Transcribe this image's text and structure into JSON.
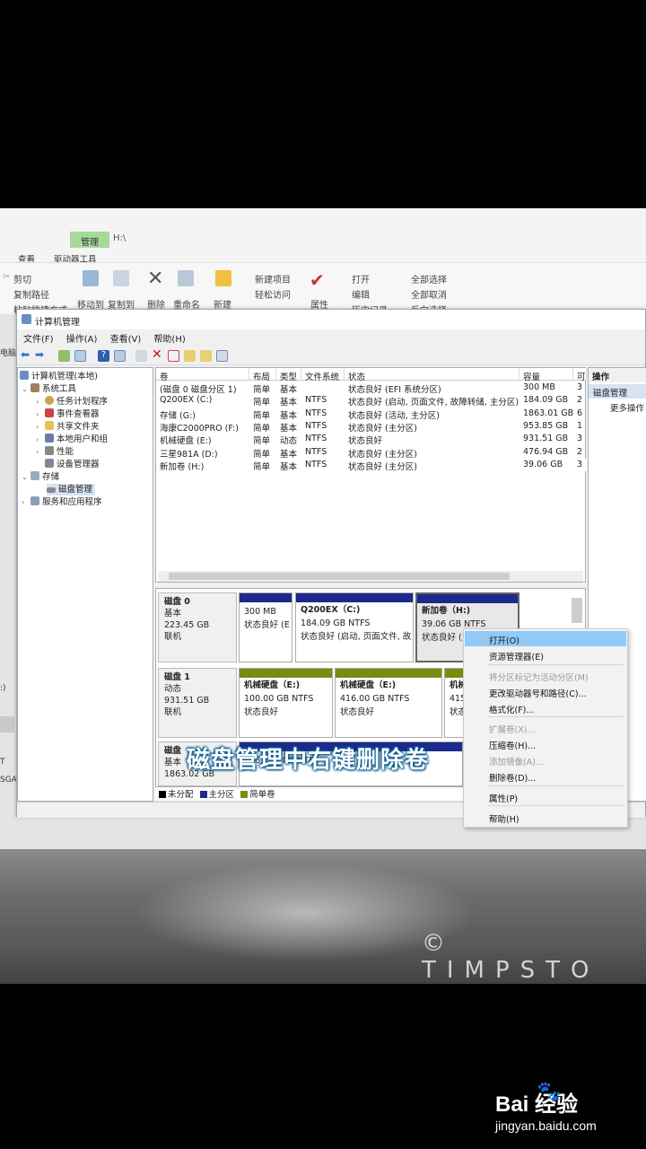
{
  "ribbon": {
    "manage_tab": "管理",
    "path": "H:\\",
    "view_tab": "查看",
    "drive_tools_tab": "驱动器工具",
    "cut": "剪切",
    "copy_path": "复制路径",
    "paste_shortcut": "粘贴快捷方式",
    "move_to": "移动到",
    "copy_to": "复制到",
    "delete": "删除",
    "rename": "重命名",
    "new": "新建",
    "new_item": "新建项目",
    "easy_access": "轻松访问",
    "properties": "属性",
    "open": "打开",
    "edit": "编辑",
    "history": "历史记录",
    "select_all": "全部选择",
    "select_none": "全部取消",
    "invert_selection": "反向选择"
  },
  "left_edge": {
    "text1": "电脑",
    "text2": ":)",
    "text3": "T",
    "text4": "SGA"
  },
  "window": {
    "title": "计算机管理",
    "menu": [
      "文件(F)",
      "操作(A)",
      "查看(V)",
      "帮助(H)"
    ]
  },
  "tree": {
    "root": "计算机管理(本地)",
    "system_tools": "系统工具",
    "task_scheduler": "任务计划程序",
    "event_viewer": "事件查看器",
    "shared_folders": "共享文件夹",
    "local_users": "本地用户和组",
    "performance": "性能",
    "device_manager": "设备管理器",
    "storage": "存储",
    "disk_management": "磁盘管理",
    "services_apps": "服务和应用程序"
  },
  "volumes": {
    "headers": [
      "卷",
      "布局",
      "类型",
      "文件系统",
      "状态",
      "容量",
      "可"
    ],
    "rows": [
      [
        "(磁盘 0 磁盘分区 1)",
        "简单",
        "基本",
        "",
        "状态良好 (EFI 系统分区)",
        "300 MB",
        "3"
      ],
      [
        "Q200EX (C:)",
        "简单",
        "基本",
        "NTFS",
        "状态良好 (启动, 页面文件, 故障转储, 主分区)",
        "184.09 GB",
        "2"
      ],
      [
        "存储 (G:)",
        "简单",
        "基本",
        "NTFS",
        "状态良好 (活动, 主分区)",
        "1863.01 GB",
        "6"
      ],
      [
        "海康C2000PRO (F:)",
        "简单",
        "基本",
        "NTFS",
        "状态良好 (主分区)",
        "953.85 GB",
        "1"
      ],
      [
        "机械硬盘 (E:)",
        "简单",
        "动态",
        "NTFS",
        "状态良好",
        "931.51 GB",
        "3"
      ],
      [
        "三星981A (D:)",
        "简单",
        "基本",
        "NTFS",
        "状态良好 (主分区)",
        "476.94 GB",
        "2"
      ],
      [
        "新加卷 (H:)",
        "简单",
        "基本",
        "NTFS",
        "状态良好 (主分区)",
        "39.06 GB",
        "3"
      ]
    ]
  },
  "disks": [
    {
      "name": "磁盘 0",
      "type": "基本",
      "size": "223.45 GB",
      "status": "联机",
      "partitions": [
        {
          "title": "",
          "line1": "300 MB",
          "line2": "状态良好 (E"
        },
        {
          "title": "Q200EX（C:)",
          "line1": "184.09 GB NTFS",
          "line2": "状态良好 (启动, 页面文件, 故"
        },
        {
          "title": "新加卷（H:)",
          "line1": "39.06 GB NTFS",
          "line2": "状态良好 (主"
        }
      ]
    },
    {
      "name": "磁盘 1",
      "type": "动态",
      "size": "931.51 GB",
      "status": "联机",
      "partitions": [
        {
          "title": "机械硬盘（E:)",
          "line1": "100.00 GB NTFS",
          "line2": "状态良好"
        },
        {
          "title": "机械硬盘（E:)",
          "line1": "416.00 GB NTFS",
          "line2": "状态良好"
        },
        {
          "title": "机械",
          "line1": "415",
          "line2": "状态"
        }
      ]
    },
    {
      "name": "磁盘",
      "type": "基本",
      "size": "1863.02 GB",
      "status": "",
      "partitions": [
        {
          "title": "",
          "line1": "1863.01 GB NTFS",
          "line2": ""
        }
      ]
    }
  ],
  "legend": {
    "unallocated": "未分配",
    "primary": "主分区",
    "simple": "简单卷"
  },
  "actions": {
    "header": "操作",
    "selected": "磁盘管理",
    "more": "更多操作"
  },
  "context_menu": {
    "items": [
      {
        "label": "打开(O)",
        "enabled": true
      },
      {
        "label": "资源管理器(E)",
        "enabled": true
      },
      {
        "label": "将分区标记为活动分区(M)",
        "enabled": false
      },
      {
        "label": "更改驱动器号和路径(C)...",
        "enabled": true
      },
      {
        "label": "格式化(F)...",
        "enabled": true
      },
      {
        "label": "扩展卷(X)...",
        "enabled": false
      },
      {
        "label": "压缩卷(H)...",
        "enabled": true
      },
      {
        "label": "添加镜像(A)...",
        "enabled": false
      },
      {
        "label": "删除卷(D)...",
        "enabled": true
      },
      {
        "label": "属性(P)",
        "enabled": true
      },
      {
        "label": "帮助(H)",
        "enabled": true
      }
    ]
  },
  "caption": "磁盘管理中右键删除卷",
  "watermark": "© TIMPSTO",
  "baidu": {
    "logo": "Bai  经验",
    "url": "jingyan.baidu.com"
  },
  "colors": {
    "primary_bar": "#1c2a8c",
    "simple_bar": "#7d8a10",
    "highlight": "#91c9f7",
    "selected": "#d7e3f2",
    "caption_outline": "#0a5a8f"
  }
}
